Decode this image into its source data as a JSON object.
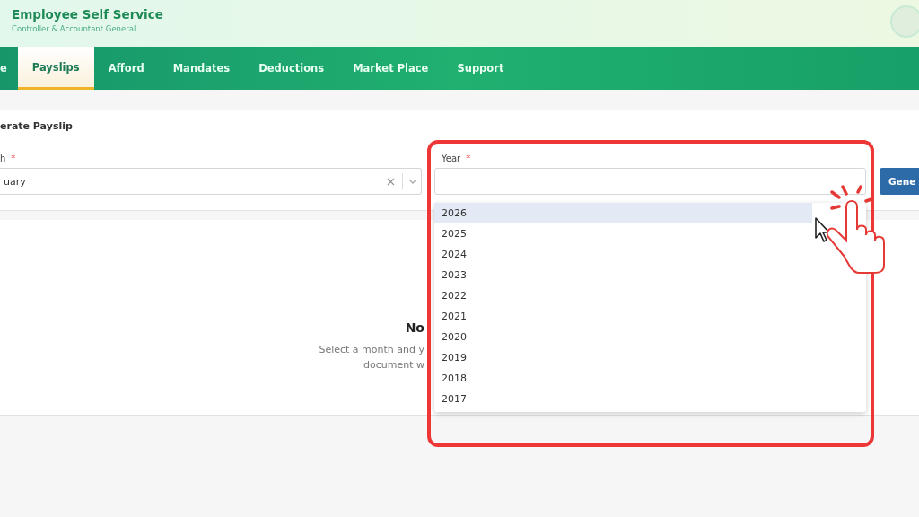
{
  "header": {
    "title": "Employee Self Service",
    "subtitle": "Controller & Accountant General"
  },
  "nav": [
    {
      "label": "e",
      "selected": false
    },
    {
      "label": "Payslips",
      "selected": true
    },
    {
      "label": "Afford",
      "selected": false
    },
    {
      "label": "Mandates",
      "selected": false
    },
    {
      "label": "Deductions",
      "selected": false
    },
    {
      "label": "Market Place",
      "selected": false
    },
    {
      "label": "Support",
      "selected": false
    }
  ],
  "form": {
    "title": "erate Payslip",
    "month": {
      "label": "h",
      "required_mark": "*",
      "value": "uary"
    },
    "year": {
      "label": "Year",
      "required_mark": "*"
    },
    "button": "Gene"
  },
  "year_options": [
    {
      "label": "2026",
      "selected": true
    },
    {
      "label": "2025",
      "selected": false
    },
    {
      "label": "2024",
      "selected": false
    },
    {
      "label": "2023",
      "selected": false
    },
    {
      "label": "2022",
      "selected": false
    },
    {
      "label": "2021",
      "selected": false
    },
    {
      "label": "2020",
      "selected": false
    },
    {
      "label": "2019",
      "selected": false
    },
    {
      "label": "2018",
      "selected": false
    },
    {
      "label": "2017",
      "selected": false
    }
  ],
  "empty_state": {
    "title": "No",
    "lines": [
      "Select a month and y",
      "document w"
    ]
  }
}
